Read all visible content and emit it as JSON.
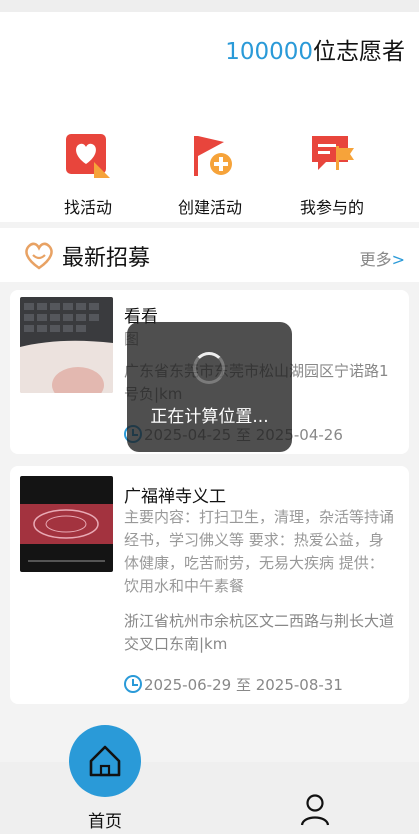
{
  "header": {
    "volunteer_count": "100000",
    "volunteer_label": "位志愿者"
  },
  "quick_actions": [
    {
      "label": "找活动",
      "icon": "heart-card-icon"
    },
    {
      "label": "创建活动",
      "icon": "flag-plus-icon"
    },
    {
      "label": "我参与的",
      "icon": "chat-flag-icon"
    }
  ],
  "recruit": {
    "title": "最新招募",
    "more": "更多",
    "more_arrow": ">"
  },
  "cards": [
    {
      "title": "看看",
      "body": "图",
      "address": "广东省东莞市东莞市松山湖园区宁诺路1号负|km",
      "date": "2025-04-25 至 2025-04-26"
    },
    {
      "title": "广福禅寺义工",
      "body": "主要内容：打扫卫生，清理，杂活等持诵经书，学习佛义等 要求：热爱公益，身体健康，吃苦耐劳，无易大疾病 提供：饮用水和中午素餐",
      "address": "浙江省杭州市余杭区文二西路与荆长大道交叉口东南|km",
      "date": "2025-06-29 至 2025-08-31"
    }
  ],
  "loading": {
    "text": "正在计算位置..."
  },
  "tabbar": {
    "home_label": "首页",
    "home_icon": "house-icon",
    "profile_icon": "user-icon"
  },
  "colors": {
    "accent": "#2a9ad8",
    "icon_red": "#e8453c",
    "icon_orange": "#f6a33a"
  }
}
